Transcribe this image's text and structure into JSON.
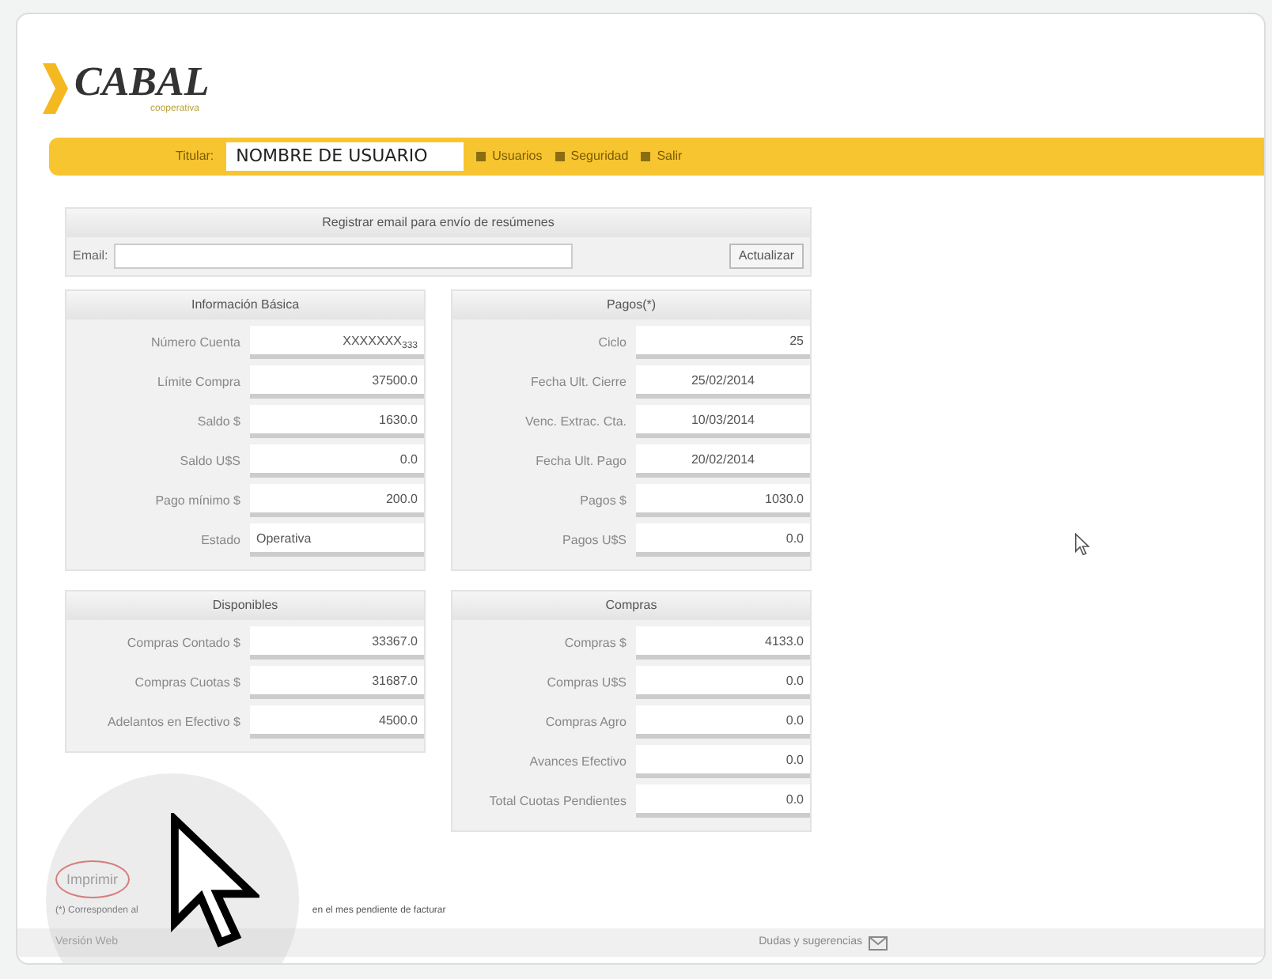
{
  "header": {
    "logo": "CABAL",
    "logo_subtitle": "cooperativa"
  },
  "nav": {
    "user_label": "Titular:",
    "user_name": "NOMBRE DE USUARIO",
    "menu": [
      {
        "label": "Usuarios"
      },
      {
        "label": "Seguridad"
      },
      {
        "label": "Salir"
      }
    ]
  },
  "email_section": {
    "title": "Registrar email para envío de resúmenes",
    "label": "Email:",
    "button": "Actualizar"
  },
  "panels": [
    {
      "title": "Información Básica",
      "rows": [
        {
          "label": "Número Cuenta",
          "value": "XXXXXXX$_{333}$",
          "kind": "number"
        },
        {
          "label": "Límite Compra",
          "value": "37500.0",
          "kind": "number"
        },
        {
          "label": "Saldo $",
          "value": "1630.0",
          "kind": "number"
        },
        {
          "label": "Saldo U$S",
          "value": "0.0",
          "kind": "number"
        },
        {
          "label": "Pago mínimo $",
          "value": "200.0",
          "kind": "number"
        },
        {
          "label": "Estado",
          "value": "Operativa",
          "kind": "text"
        }
      ]
    },
    {
      "title": "Pagos(*)",
      "rows": [
        {
          "label": "Ciclo",
          "value": "25",
          "kind": "number"
        },
        {
          "label": "Fecha Ult. Cierre",
          "value": "25/02/2014",
          "kind": "date"
        },
        {
          "label": "Venc. Extrac. Cta.",
          "value": "10/03/2014",
          "kind": "date"
        },
        {
          "label": "Fecha Ult. Pago",
          "value": "20/02/2014",
          "kind": "date"
        },
        {
          "label": "Pagos $",
          "value": "1030.0",
          "kind": "number"
        },
        {
          "label": "Pagos U$S",
          "value": "0.0",
          "kind": "number"
        }
      ]
    },
    {
      "title": "Disponibles",
      "rows": [
        {
          "label": "Compras Contado $",
          "value": "33367.0",
          "kind": "number"
        },
        {
          "label": "Compras Cuotas $",
          "value": "31687.0",
          "kind": "number"
        },
        {
          "label": "Adelantos en Efectivo $",
          "value": "4500.0",
          "kind": "number"
        }
      ]
    },
    {
      "title": "Compras",
      "rows": [
        {
          "label": "Compras $",
          "value": "4133.0",
          "kind": "number"
        },
        {
          "label": "Compras U$S",
          "value": "0.0",
          "kind": "number"
        },
        {
          "label": "Compras Agro",
          "value": "0.0",
          "kind": "number"
        },
        {
          "label": "Avances Efectivo",
          "value": "0.0",
          "kind": "number"
        },
        {
          "label": "Total Cuotas Pendientes",
          "value": "0.0",
          "kind": "number"
        }
      ]
    }
  ],
  "print_link": "Imprimir",
  "footnote": [
    "(*) Corresponden al",
    "en el mes pendiente de facturar"
  ],
  "footer": {
    "left": "Versión Web",
    "right": "Dudas y sugerencias"
  }
}
